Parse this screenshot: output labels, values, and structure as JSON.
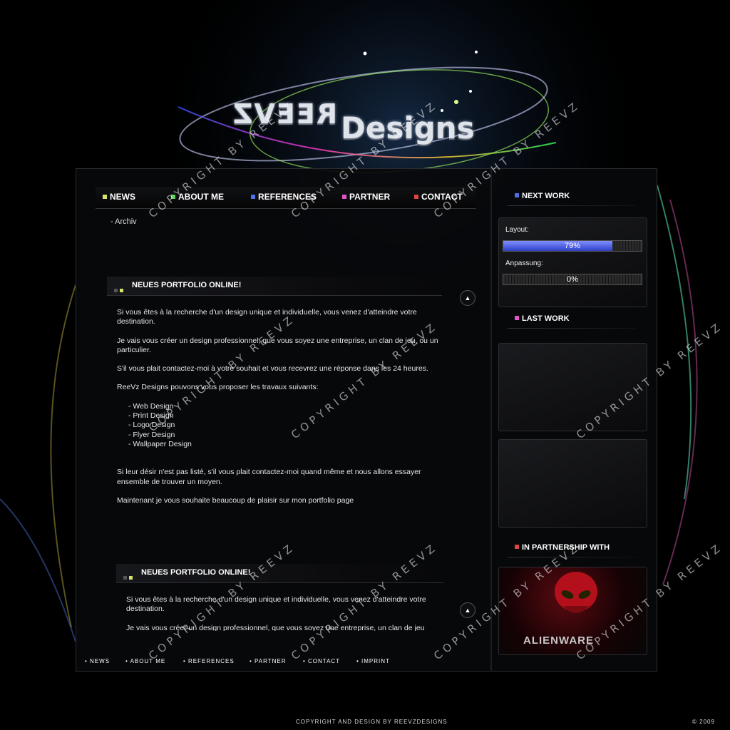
{
  "logo": {
    "part1": "REEVZ",
    "part2": "Designs"
  },
  "nav": [
    {
      "label": "NEWS",
      "color": "#d9e36a"
    },
    {
      "label": "ABOUT ME",
      "color": "#5fd35f"
    },
    {
      "label": "REFERENCES",
      "color": "#4f6ee8"
    },
    {
      "label": "PARTNER",
      "color": "#e055c8"
    },
    {
      "label": "CONTACT",
      "color": "#e04545"
    }
  ],
  "archiv": "- Archiv",
  "posts": [
    {
      "title": "NEUES PORTFOLIO ONLINE!",
      "paragraphs": [
        "Si vous êtes à la recherche d'un design unique et individuelle, vous venez d'atteindre votre destination.",
        "Je vais vous créer un design professionnel, que vous soyez une entreprise, un clan de jeu, ou un particulier.",
        "S'il vous plait contactez-moi à votre souhait et vous recevrez une réponse dans les 24 heures.",
        "ReeVz Designs pouvons vous proposer les travaux suivants:"
      ],
      "services": [
        "- Web Design",
        "- Print Design",
        "- Logo Design",
        "- Flyer Design",
        "- Wallpaper Design"
      ],
      "after": [
        "Si leur désir n'est pas listé, s'il vous plait contactez-moi quand même et nous allons essayer ensemble de trouver un moyen.",
        "Maintenant je vous souhaite beaucoup de plaisir sur mon portfolio page"
      ]
    },
    {
      "title": "NEUES PORTFOLIO ONLINE!",
      "paragraphs": [
        "Si vous êtes à la recherche d'un design unique et individuelle, vous venez d'atteindre votre destination.",
        "Je vais vous créer un design professionnel, que vous soyez une entreprise, un clan de jeu"
      ]
    }
  ],
  "sidebar": {
    "next_work": {
      "title": "NEXT WORK",
      "color": "#4f6ee8",
      "items": [
        {
          "label": "Layout:",
          "progress": 0.79,
          "text": "79%"
        },
        {
          "label": "Anpassung:",
          "progress": 0.0,
          "text": "0%"
        }
      ]
    },
    "last_work": {
      "title": "LAST WORK",
      "color": "#e055c8"
    },
    "partnership": {
      "title": "IN PARTNERSHIP WITH",
      "color": "#e04545",
      "partner": "ALIENWARE"
    }
  },
  "footer": {
    "nav": [
      "• NEWS",
      "• ABOUT ME",
      "• REFERENCES",
      "• PARTNER",
      "• CONTACT",
      "• IMPRINT"
    ],
    "copyright": "COPYRIGHT AND DESIGN BY REEVZDESIGNS",
    "year": "© 2009"
  },
  "watermark": "COPYRIGHT BY REEVZ"
}
